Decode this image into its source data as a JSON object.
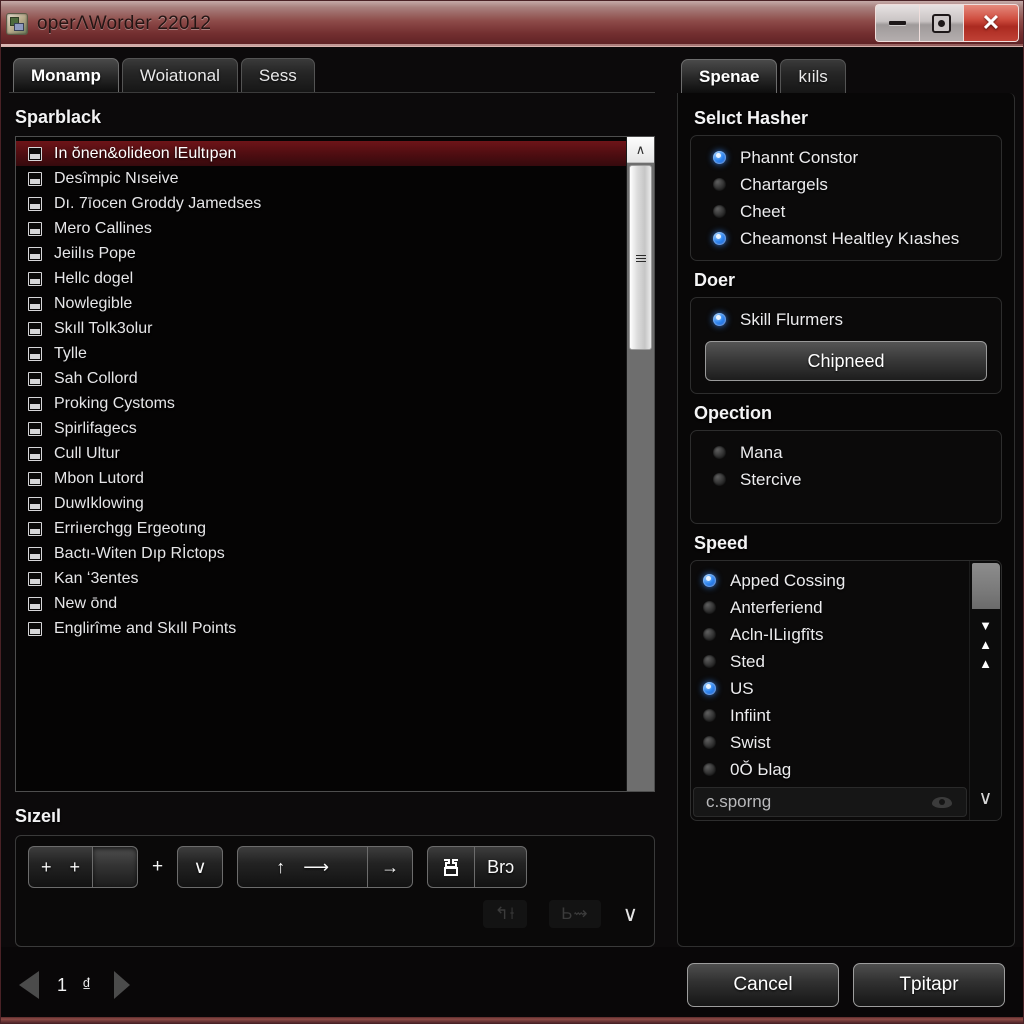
{
  "window": {
    "title": "operΛWorder 22012",
    "icon": "app-icon",
    "buttons": {
      "minimize": "—",
      "maximize": "□",
      "close": "✕"
    }
  },
  "left": {
    "tabs": [
      {
        "label": "Monamp",
        "active": true
      },
      {
        "label": "Woiatıonal",
        "active": false
      },
      {
        "label": "Sess",
        "active": false
      }
    ],
    "list_label": "Sparblack",
    "items": [
      {
        "label": "In ŏnen&olideon lEultıpən",
        "selected": true
      },
      {
        "label": "Desîmpic Nısеive",
        "selected": false
      },
      {
        "label": "Dı. 7īocen Groddy Jamedses",
        "selected": false
      },
      {
        "label": "Mеro Callines",
        "selected": false
      },
      {
        "label": "Jеiilıs Pope",
        "selected": false
      },
      {
        "label": "Hellc dogel",
        "selected": false
      },
      {
        "label": "Nowlegible",
        "selected": false
      },
      {
        "label": "Skıll Tolk3olur",
        "selected": false
      },
      {
        "label": "Tylle",
        "selected": false
      },
      {
        "label": "Sah Collord",
        "selected": false
      },
      {
        "label": "Proking Cystoms",
        "selected": false
      },
      {
        "label": "Spirlifagecs",
        "selected": false
      },
      {
        "label": "Cull Ultur",
        "selected": false
      },
      {
        "label": "Mbon Lutord",
        "selected": false
      },
      {
        "label": "DuwIklowing",
        "selected": false
      },
      {
        "label": "Erriıerchgg Ergеotıng",
        "selected": false
      },
      {
        "label": "Bactı-Witen Dıp Rİctops",
        "selected": false
      },
      {
        "label": "Kan ʻ3entes",
        "selected": false
      },
      {
        "label": "New ōnd",
        "selected": false
      },
      {
        "label": "Englirîme and Skıll Points",
        "selected": false
      }
    ],
    "scrollbar": {
      "up_glyph": "∧",
      "grip": "grip-lines"
    },
    "toolbar_label": "Sızeıl",
    "toolbar": {
      "group1": [
        "+",
        "+",
        ""
      ],
      "separator": "+",
      "dropdown": "∨",
      "group2": {
        "wide_left": "↑",
        "wide_right": "⟶",
        "next": "→"
      },
      "group3": {
        "stamp": "stamp-glyph",
        "text": "Brɔ"
      },
      "ghost_icons": [
        "ghost-icon-left",
        "ghost-icon-right"
      ],
      "sub_chevron": "∨"
    }
  },
  "right": {
    "tabs": [
      {
        "label": "Spenae",
        "active": true
      },
      {
        "label": "kıils",
        "active": false
      }
    ],
    "groups": [
      {
        "label": "Selıct Hasher",
        "options": [
          {
            "label": "Phannt Constor",
            "on": true
          },
          {
            "label": "Chartargels",
            "on": false
          },
          {
            "label": "Cheet",
            "on": false
          },
          {
            "label": "Cheamonst Healtley Kıashes",
            "on": true
          }
        ]
      },
      {
        "label": "Doer",
        "options": [
          {
            "label": "Skill Flurmers",
            "on": true
          }
        ],
        "button": "Chipneed"
      },
      {
        "label": "Opection",
        "options": [
          {
            "label": "Mana",
            "on": false
          },
          {
            "label": "Stercive",
            "on": false
          }
        ]
      }
    ],
    "speed": {
      "label": "Speed",
      "options": [
        {
          "label": "Apped Cossing",
          "on": true
        },
        {
          "label": "Anterferiend",
          "on": false
        },
        {
          "label": "Acln-ILiıgfîts",
          "on": false
        },
        {
          "label": "Sted",
          "on": false
        },
        {
          "label": "US",
          "on": true
        },
        {
          "label": "Infiint",
          "on": false
        },
        {
          "label": "Swist",
          "on": false
        },
        {
          "label": "0Ŏ Ьlag",
          "on": false
        }
      ],
      "footer": {
        "text": "c.sporng",
        "icon": "eye-icon"
      },
      "scrollbar": {
        "arrows": [
          "▼",
          "▲",
          "▲"
        ],
        "bottom_glyph": "∨"
      }
    }
  },
  "footer": {
    "prev_icon": "triangle-left-icon",
    "pager_text": "1 ₫",
    "next_icon": "triangle-right-icon",
    "cancel": "Cancel",
    "confirm": "Tpitapr"
  },
  "colors": {
    "titlebar_red": "#8d4a48",
    "selection_red": "#4d0d11",
    "radio_blue": "#2f86f0",
    "panel_black": "#0a0909"
  }
}
